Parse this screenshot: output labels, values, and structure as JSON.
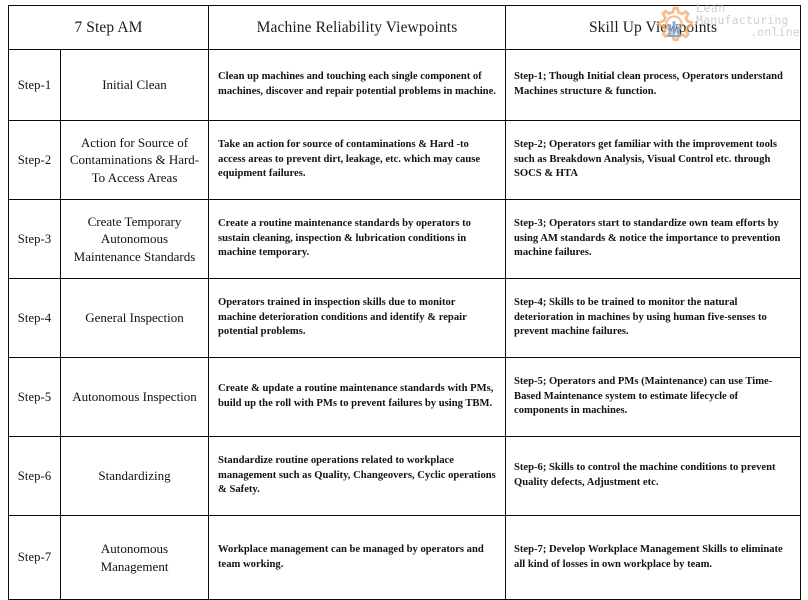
{
  "watermark": {
    "line1": "Lean",
    "line2": "Manufacturing",
    "line3": ".online",
    "logo_icon": "gear-icon",
    "logo_color": "#f2a86b",
    "text_color": "#cfcfcf"
  },
  "table": {
    "headers": {
      "step_group": "7 Step AM",
      "machine": "Machine Reliability Viewpoints",
      "skill": "Skill Up Viewpoints"
    },
    "rows": [
      {
        "step": "Step-1",
        "name": "Initial Clean",
        "machine": "Clean up machines and touching each single component of machines, discover and repair potential problems in machine.",
        "skill": "Step-1; Though Initial clean process, Operators understand Machines structure & function."
      },
      {
        "step": "Step-2",
        "name": "Action for Source of Contaminations & Hard-To Access Areas",
        "machine": "Take an action for source of contaminations & Hard -to access areas to prevent dirt, leakage, etc. which may cause equipment failures.",
        "skill": "Step-2; Operators get familiar with the improvement tools such as Breakdown Analysis, Visual Control etc. through SOCS & HTA"
      },
      {
        "step": "Step-3",
        "name": "Create Temporary Autonomous Maintenance Standards",
        "machine": "Create a routine maintenance standards by operators to sustain cleaning, inspection & lubrication conditions in machine temporary.",
        "skill": "Step-3; Operators start to standardize own team efforts by using AM standards & notice the importance to prevention machine failures."
      },
      {
        "step": "Step-4",
        "name": "General Inspection",
        "machine": "Operators trained in inspection skills due to monitor machine deterioration conditions and identify & repair potential problems.",
        "skill": "Step-4; Skills to be trained to monitor the natural deterioration in machines by using human five-senses to prevent machine failures."
      },
      {
        "step": "Step-5",
        "name": "Autonomous Inspection",
        "machine": "Create & update a routine maintenance standards with PMs, build up the roll with PMs to prevent failures by using TBM.",
        "skill": "Step-5; Operators and PMs (Maintenance) can use Time-Based Maintenance system to estimate lifecycle of components in machines."
      },
      {
        "step": "Step-6",
        "name": "Standardizing",
        "machine": "Standardize routine operations related to workplace management such as Quality, Changeovers, Cyclic operations & Safety.",
        "skill": "Step-6; Skills to control the machine conditions to prevent Quality defects, Adjustment etc."
      },
      {
        "step": "Step-7",
        "name": "Autonomous Management",
        "machine": "Workplace management can be managed by operators and team working.",
        "skill": "Step-7; Develop Workplace Management Skills to eliminate all kind of losses in own workplace by team."
      }
    ]
  }
}
